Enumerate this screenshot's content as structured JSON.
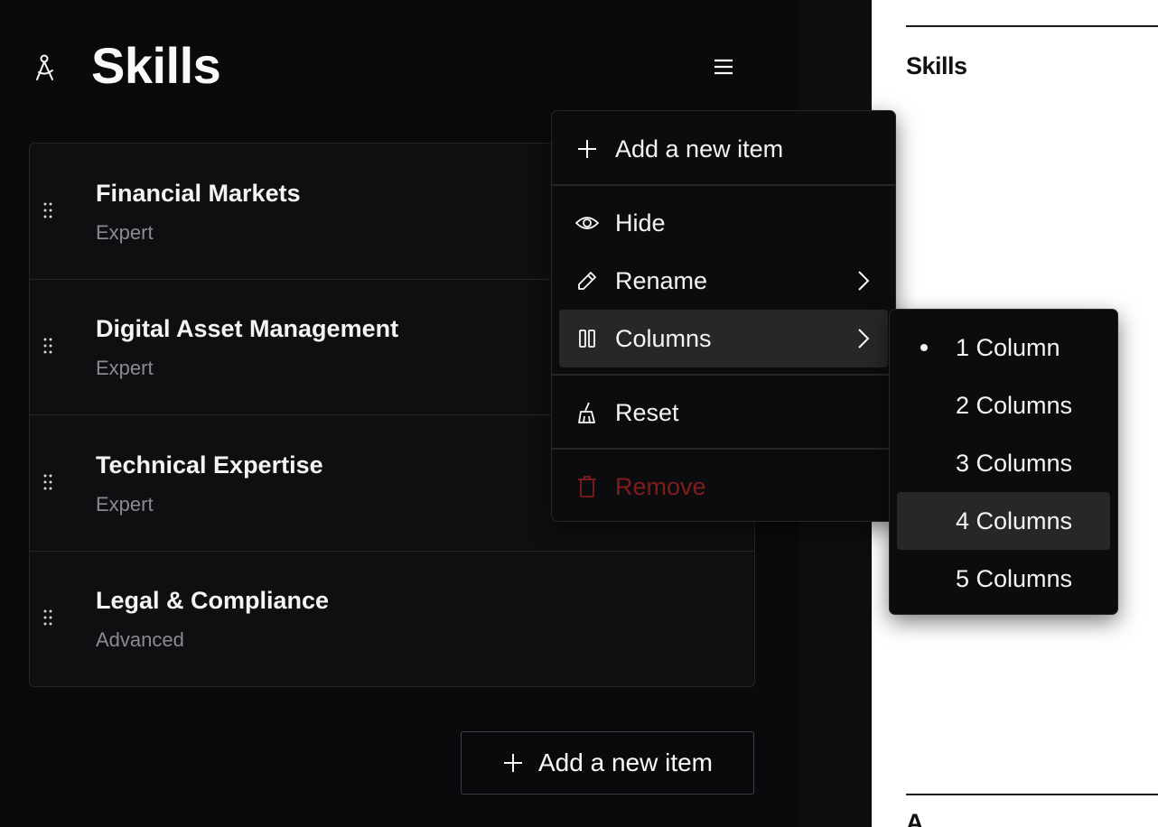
{
  "section": {
    "title": "Skills",
    "icon": "compass-icon",
    "menu_icon": "hamburger-icon"
  },
  "items": [
    {
      "name": "Financial Markets",
      "level": "Expert"
    },
    {
      "name": "Digital Asset Management",
      "level": "Expert"
    },
    {
      "name": "Technical Expertise",
      "level": "Expert"
    },
    {
      "name": "Legal & Compliance",
      "level": "Advanced"
    }
  ],
  "add_button": {
    "label": "Add a new item",
    "icon": "plus-icon"
  },
  "dropdown": {
    "add": "Add a new item",
    "hide": "Hide",
    "rename": "Rename",
    "columns": "Columns",
    "reset": "Reset",
    "remove": "Remove"
  },
  "columns_submenu": {
    "options": [
      "1 Column",
      "2 Columns",
      "3 Columns",
      "4 Columns",
      "5 Columns"
    ],
    "selected": "1 Column",
    "highlighted": "4 Columns"
  },
  "preview": {
    "title": "Skills",
    "next_section": "A"
  },
  "colors": {
    "background": "#0a0a0c",
    "surface": "#0f0f11",
    "border": "#27272a",
    "highlight": "#27272a",
    "danger": "#7f1d1d",
    "muted_text": "#8a8a92"
  }
}
